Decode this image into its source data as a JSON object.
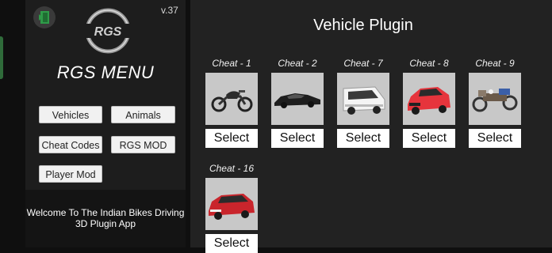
{
  "app": {
    "version": "v.37",
    "logo_text": "RGS",
    "menu_title": "RGS MENU",
    "welcome": "Welcome To The Indian Bikes Driving 3D Plugin App"
  },
  "sidebar": {
    "buttons": [
      {
        "label": "Vehicles"
      },
      {
        "label": "Animals"
      },
      {
        "label": "Cheat Codes"
      },
      {
        "label": "RGS MOD"
      },
      {
        "label": "Player Mod"
      }
    ]
  },
  "main": {
    "title": "Vehicle Plugin",
    "cards": [
      {
        "title": "Cheat - 1",
        "icon": "motorcycle-icon",
        "select": "Select"
      },
      {
        "title": "Cheat - 2",
        "icon": "sports-car-icon",
        "select": "Select"
      },
      {
        "title": "Cheat - 7",
        "icon": "van-icon",
        "select": "Select"
      },
      {
        "title": "Cheat - 8",
        "icon": "hatchback-car-icon",
        "select": "Select"
      },
      {
        "title": "Cheat - 9",
        "icon": "atv-icon",
        "select": "Select"
      },
      {
        "title": "Cheat - 16",
        "icon": "suv-icon",
        "select": "Select"
      }
    ]
  },
  "colors": {
    "sidebar_bg": "#1d1d1d",
    "main_bg": "#222222",
    "button_bg": "#f1f1f1",
    "exit_green": "#2e9b48"
  }
}
